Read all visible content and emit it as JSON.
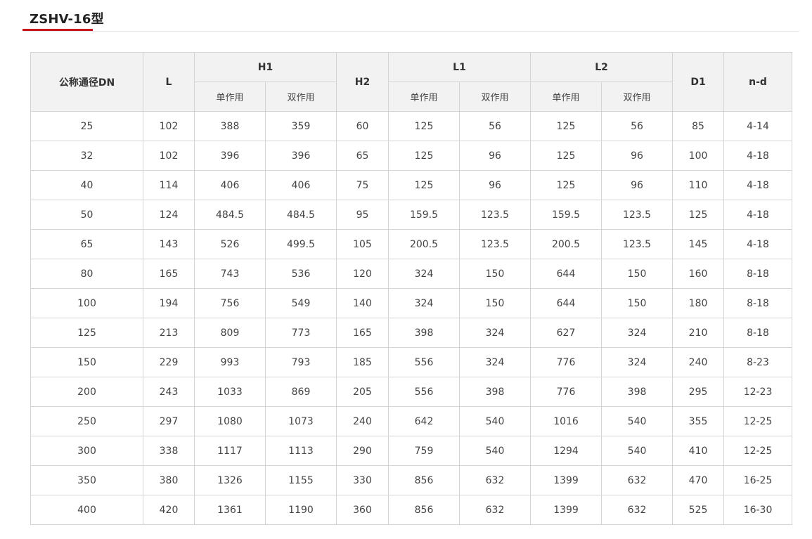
{
  "title": "ZSHV-16型",
  "table": {
    "headers": {
      "dn": "公称通径DN",
      "l": "L",
      "h1": "H1",
      "h2": "H2",
      "l1": "L1",
      "l2": "L2",
      "d1": "D1",
      "nd": "n-d",
      "single": "单作用",
      "double": "双作用"
    },
    "rows": [
      [
        "25",
        "102",
        "388",
        "359",
        "60",
        "125",
        "56",
        "125",
        "56",
        "85",
        "4-14"
      ],
      [
        "32",
        "102",
        "396",
        "396",
        "65",
        "125",
        "96",
        "125",
        "96",
        "100",
        "4-18"
      ],
      [
        "40",
        "114",
        "406",
        "406",
        "75",
        "125",
        "96",
        "125",
        "96",
        "110",
        "4-18"
      ],
      [
        "50",
        "124",
        "484.5",
        "484.5",
        "95",
        "159.5",
        "123.5",
        "159.5",
        "123.5",
        "125",
        "4-18"
      ],
      [
        "65",
        "143",
        "526",
        "499.5",
        "105",
        "200.5",
        "123.5",
        "200.5",
        "123.5",
        "145",
        "4-18"
      ],
      [
        "80",
        "165",
        "743",
        "536",
        "120",
        "324",
        "150",
        "644",
        "150",
        "160",
        "8-18"
      ],
      [
        "100",
        "194",
        "756",
        "549",
        "140",
        "324",
        "150",
        "644",
        "150",
        "180",
        "8-18"
      ],
      [
        "125",
        "213",
        "809",
        "773",
        "165",
        "398",
        "324",
        "627",
        "324",
        "210",
        "8-18"
      ],
      [
        "150",
        "229",
        "993",
        "793",
        "185",
        "556",
        "324",
        "776",
        "324",
        "240",
        "8-23"
      ],
      [
        "200",
        "243",
        "1033",
        "869",
        "205",
        "556",
        "398",
        "776",
        "398",
        "295",
        "12-23"
      ],
      [
        "250",
        "297",
        "1080",
        "1073",
        "240",
        "642",
        "540",
        "1016",
        "540",
        "355",
        "12-25"
      ],
      [
        "300",
        "338",
        "1117",
        "1113",
        "290",
        "759",
        "540",
        "1294",
        "540",
        "410",
        "12-25"
      ],
      [
        "350",
        "380",
        "1326",
        "1155",
        "330",
        "856",
        "632",
        "1399",
        "632",
        "470",
        "16-25"
      ],
      [
        "400",
        "420",
        "1361",
        "1190",
        "360",
        "856",
        "632",
        "1399",
        "632",
        "525",
        "16-30"
      ]
    ]
  },
  "colors": {
    "accent": "#c9151e",
    "header_bg": "#f2f2f2",
    "border": "#d4d4d4"
  }
}
